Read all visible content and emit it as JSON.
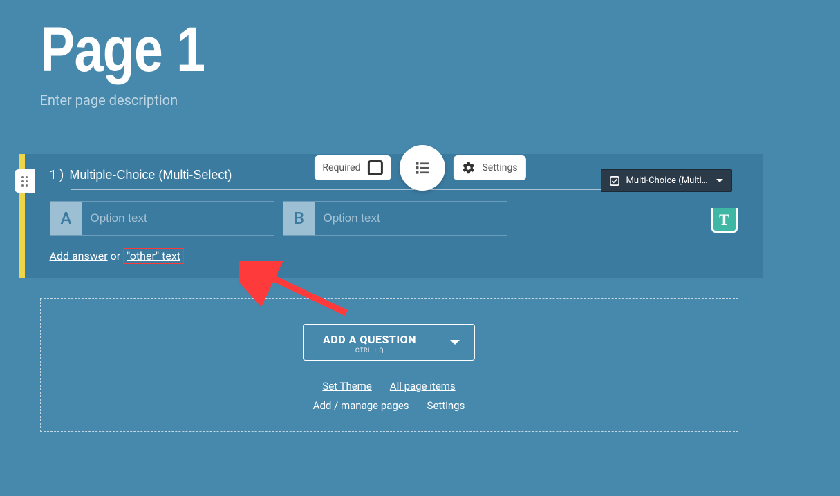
{
  "page": {
    "title": "Page 1",
    "description_placeholder": "Enter page description"
  },
  "toolbar": {
    "required_label": "Required",
    "settings_label": "Settings"
  },
  "question": {
    "number": "1 )",
    "title": "Multiple-Choice (Multi-Select)",
    "type_label": "Multi-Choice (Multi …",
    "options": [
      {
        "letter": "A",
        "placeholder": "Option text"
      },
      {
        "letter": "B",
        "placeholder": "Option text"
      }
    ],
    "add_answer_label": "Add answer",
    "or_label": " or ",
    "other_text_label": "\"other\" text",
    "text_tab_label": "T"
  },
  "add_area": {
    "button_label": "ADD A QUESTION",
    "shortcut": "CTRL + Q",
    "links": {
      "set_theme": "Set Theme",
      "all_page_items": "All page items",
      "manage_pages": "Add / manage pages",
      "settings": "Settings"
    }
  }
}
